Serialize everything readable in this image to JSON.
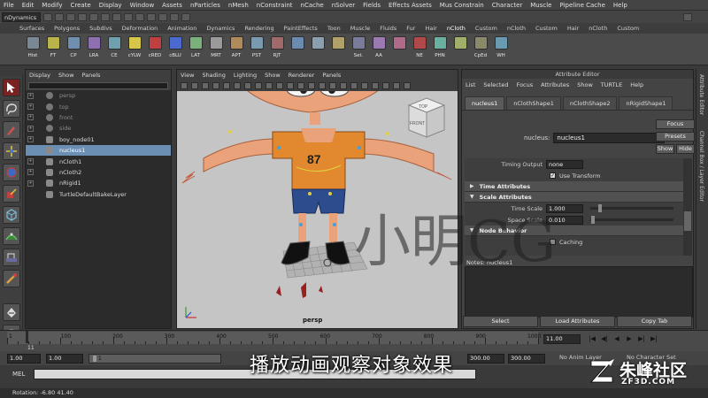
{
  "menubar": [
    "File",
    "Edit",
    "Modify",
    "Create",
    "Display",
    "Window",
    "Assets",
    "nParticles",
    "nMesh",
    "nConstraint",
    "nCache",
    "nSolver",
    "Fields",
    "Effects Assets",
    "Mus Constrain",
    "Character",
    "Muscle",
    "Pipeline Cache",
    "Help"
  ],
  "statusline": {
    "mode": "nDynamics"
  },
  "shelf_tabs": [
    "Surfaces",
    "Polygons",
    "Subdivs",
    "Deformation",
    "Animation",
    "Dynamics",
    "Rendering",
    "PaintEffects",
    "Toon",
    "Muscle",
    "Fluids",
    "Fur",
    "Hair",
    "nCloth",
    "Custom",
    "nCloth",
    "Custom",
    "Hair",
    "nCloth",
    "Custom"
  ],
  "shelf_icons": [
    {
      "label": "Hist",
      "color": "#7a8794"
    },
    {
      "label": "FT",
      "color": "#b8b34a"
    },
    {
      "label": "CP",
      "color": "#6f8fb0"
    },
    {
      "label": "LRA",
      "color": "#8e6fb0"
    },
    {
      "label": "CE",
      "color": "#6fa0b0"
    },
    {
      "label": "cYLW",
      "color": "#d6c64a"
    },
    {
      "label": "cRED",
      "color": "#c04040"
    },
    {
      "label": "cBLU",
      "color": "#4a6ad0"
    },
    {
      "label": "LAT",
      "color": "#7ab07a"
    },
    {
      "label": "MRT",
      "color": "#9a9a9a"
    },
    {
      "label": "APT",
      "color": "#b08a5a"
    },
    {
      "label": "PST",
      "color": "#7a9ab0"
    },
    {
      "label": "RJT",
      "color": "#a06a6a"
    },
    {
      "label": "",
      "color": "#6a8ab0"
    },
    {
      "label": "",
      "color": "#8aa0b0"
    },
    {
      "label": "",
      "color": "#b0a06a"
    },
    {
      "label": "Set.",
      "color": "#7a7a9a"
    },
    {
      "label": "AA",
      "color": "#9a7ab0"
    },
    {
      "label": "",
      "color": "#b06a8a"
    },
    {
      "label": "NE",
      "color": "#b04a4a"
    },
    {
      "label": "PHN",
      "color": "#6ab0a0"
    },
    {
      "label": "",
      "color": "#a0b06a"
    },
    {
      "label": "CpEd",
      "color": "#8a8a6a"
    },
    {
      "label": "WH",
      "color": "#6a9ab0"
    }
  ],
  "outliner": {
    "menu": [
      "Display",
      "Show",
      "Panels"
    ],
    "items": [
      {
        "label": "persp",
        "dim": true,
        "expand": true,
        "type": "cam"
      },
      {
        "label": "top",
        "dim": true,
        "expand": true,
        "type": "cam"
      },
      {
        "label": "front",
        "dim": true,
        "expand": true,
        "type": "cam"
      },
      {
        "label": "side",
        "dim": true,
        "expand": true,
        "type": "cam"
      },
      {
        "label": "boy_node01",
        "dim": false,
        "expand": true,
        "type": "obj"
      },
      {
        "label": "nucleus1",
        "dim": false,
        "expand": false,
        "type": "obj",
        "selected": true
      },
      {
        "label": "nCloth1",
        "dim": false,
        "expand": true,
        "type": "obj"
      },
      {
        "label": "nCloth2",
        "dim": false,
        "expand": true,
        "type": "obj"
      },
      {
        "label": "nRigid1",
        "dim": false,
        "expand": true,
        "type": "obj"
      },
      {
        "label": "TurtleDefaultBakeLayer",
        "dim": false,
        "expand": false,
        "type": "obj"
      }
    ]
  },
  "viewport": {
    "menu": [
      "View",
      "Shading",
      "Lighting",
      "Show",
      "Renderer",
      "Panels"
    ],
    "camera_label": "persp",
    "shirt_number": "87",
    "cube_top": "TOP",
    "cube_front": "FRONT"
  },
  "attribute_editor": {
    "title": "Attribute Editor",
    "menu": [
      "List",
      "Selected",
      "Focus",
      "Attributes",
      "Show",
      "TURTLE",
      "Help"
    ],
    "tabs": [
      "nucleus1",
      "nClothShape1",
      "nClothShape2",
      "nRigidShape1"
    ],
    "node_label": "nucleus:",
    "node_value": "nucleus1",
    "focus": "Focus",
    "presets": "Presets",
    "show": "Show",
    "hide": "Hide",
    "timing_output_label": "Timing Output",
    "timing_output_value": "none",
    "use_transform": "Use Transform",
    "sections": {
      "time": "Time Attributes",
      "scale": "Scale Attributes",
      "node": "Node Behavior"
    },
    "time_scale_label": "Time Scale",
    "time_scale_value": "1.000",
    "time_scale_level": 0.1,
    "space_scale_label": "Space Scale",
    "space_scale_value": "0.010",
    "space_scale_level": 0.01,
    "caching": "Caching",
    "notes": "Notes:  nucleus1",
    "buttons": [
      "Select",
      "Load Attributes",
      "Copy Tab"
    ]
  },
  "side_tabs": [
    "Attribute Editor",
    "Channel Box / Layer Editor"
  ],
  "timeline": {
    "ticks": [
      "1",
      "100",
      "200",
      "300",
      "400",
      "500",
      "600",
      "700",
      "800",
      "900",
      "1000"
    ],
    "current_frame": "11",
    "current_frame_field": "11.00",
    "playback": [
      "|◀",
      "◀|",
      "◀",
      "▶",
      "▶|",
      "▶|"
    ]
  },
  "range": {
    "start": "1.00",
    "start2": "1.00",
    "range_marker": "1",
    "end": "300.00",
    "end2": "300.00",
    "anim_layer": "No Anim Layer",
    "character_set": "No Character Set"
  },
  "mel_label": "MEL",
  "helpline": "Rotation:   -6.80        41.40",
  "overlay": {
    "subtitle": "播放动画观察对象效果",
    "watermark": "小明CG",
    "logo_name": "朱峰社区",
    "logo_url": "ZF3D.COM"
  }
}
